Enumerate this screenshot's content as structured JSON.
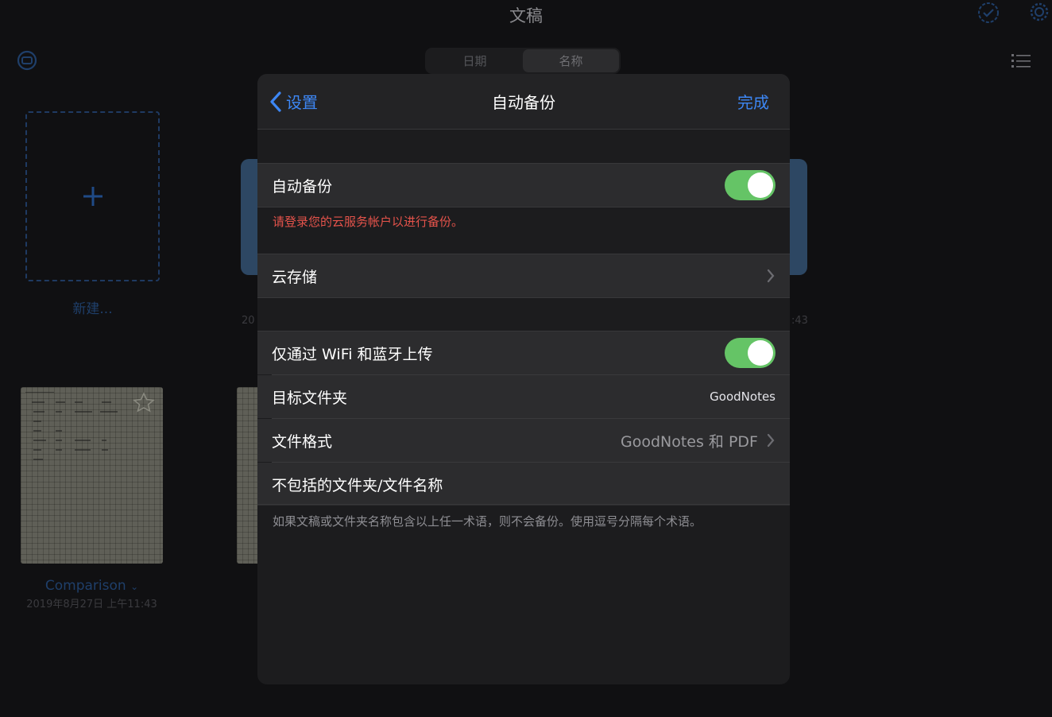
{
  "app": {
    "title": "文稿",
    "sort_tabs": [
      "日期",
      "名称"
    ],
    "active_sort_index": 1,
    "new_label": "新建...",
    "documents": [
      {
        "title": "Comparison",
        "date": "2019年8月27日 上午11:43"
      }
    ],
    "partial_date_left": "20",
    "partial_date_right": ":43"
  },
  "modal": {
    "back_label": "设置",
    "title": "自动备份",
    "done_label": "完成",
    "auto_backup_label": "自动备份",
    "auto_backup_on": true,
    "login_warning": "请登录您的云服务帐户以进行备份。",
    "cloud_storage_label": "云存储",
    "wifi_only_label": "仅通过 WiFi 和蓝牙上传",
    "wifi_only_on": true,
    "target_folder_label": "目标文件夹",
    "target_folder_value": "GoodNotes",
    "file_format_label": "文件格式",
    "file_format_value": "GoodNotes 和 PDF",
    "excluded_label": "不包括的文件夹/文件名称",
    "excluded_footer": "如果文稿或文件夹名称包含以上任一术语，则不会备份。使用逗号分隔每个术语。"
  },
  "colors": {
    "accent": "#3d87f5",
    "toggle_on": "#65c466",
    "warning": "#e5534b"
  }
}
